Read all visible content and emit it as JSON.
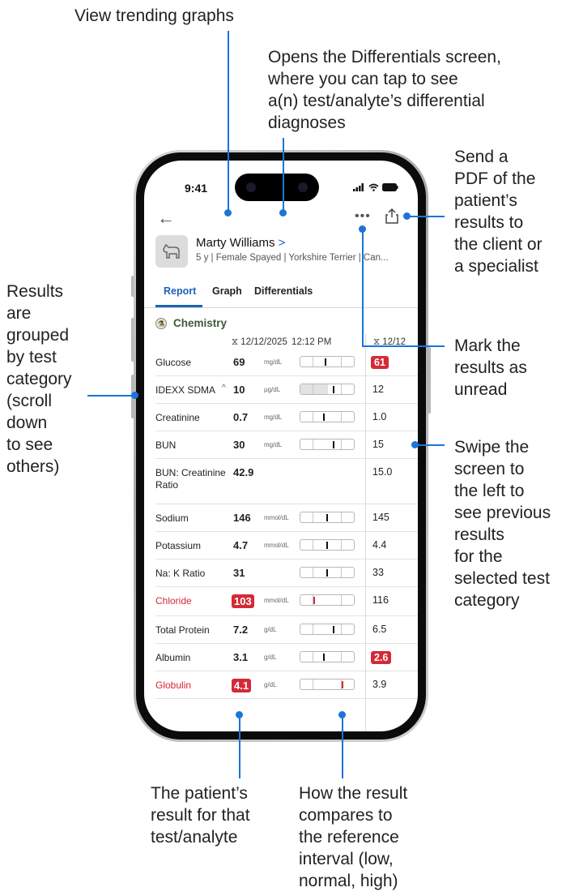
{
  "annotations": {
    "trending": "View trending graphs",
    "differentials": "Opens the Differentials screen,\nwhere you can tap to see\na(n) test/analyte’s differential\ndiagnoses",
    "send_pdf": "Send a\nPDF of the\npatient’s\nresults to\nthe client or\na specialist",
    "grouped": "Results\nare\ngrouped\nby test\ncategory\n(scroll\ndown\nto see\nothers)",
    "mark_unread": "Mark the\nresults as\nunread",
    "swipe": "Swipe the\nscreen to\nthe left to\nsee previous\nresults\nfor the\nselected test\ncategory",
    "patient_result": "The patient’s\nresult for that\ntest/analyte",
    "compare": "How the result\ncompares to\nthe reference\ninterval (low,\nnormal, high)"
  },
  "status": {
    "time": "9:41"
  },
  "patient": {
    "name": "Marty Williams",
    "chevron": ">",
    "info": "5 y | Female Spayed | Yorkshire Terrier | Can..."
  },
  "tabs": [
    {
      "label": "Report",
      "active": true
    },
    {
      "label": "Graph",
      "active": false
    },
    {
      "label": "Differentials",
      "active": false
    }
  ],
  "category": {
    "label": "Chemistry",
    "icon": "flask-icon"
  },
  "dates": {
    "current": "12/12/2025",
    "current_time": "12:12 PM",
    "previous": "12/12"
  },
  "rows": [
    {
      "name": "Glucose",
      "value": "69",
      "unit": "mg/dL",
      "prev": "61",
      "prev_flag": true,
      "value_flag": false,
      "name_flag": false,
      "marker": 0.45
    },
    {
      "name": "IDEXX SDMA",
      "trend": "^",
      "value": "10",
      "unit": "µg/dL",
      "prev": "12",
      "prev_flag": false,
      "value_flag": false,
      "name_flag": false,
      "marker": 0.6
    },
    {
      "name": "Creatinine",
      "value": "0.7",
      "unit": "mg/dL",
      "prev": "1.0",
      "prev_flag": false,
      "value_flag": false,
      "name_flag": false,
      "marker": 0.42
    },
    {
      "name": "BUN",
      "value": "30",
      "unit": "mg/dL",
      "prev": "15",
      "prev_flag": false,
      "value_flag": false,
      "name_flag": false,
      "marker": 0.6
    },
    {
      "name": "BUN: Creatinine Ratio",
      "value": "42.9",
      "unit": "",
      "prev": "15.0",
      "prev_flag": false,
      "value_flag": false,
      "name_flag": false,
      "marker": null
    },
    {
      "name": "Sodium",
      "value": "146",
      "unit": "mmol/dL",
      "prev": "145",
      "prev_flag": false,
      "value_flag": false,
      "name_flag": false,
      "marker": 0.48
    },
    {
      "name": "Potassium",
      "value": "4.7",
      "unit": "mmol/dL",
      "prev": "4.4",
      "prev_flag": false,
      "value_flag": false,
      "name_flag": false,
      "marker": 0.48
    },
    {
      "name": "Na: K Ratio",
      "value": "31",
      "unit": "",
      "prev": "33",
      "prev_flag": false,
      "value_flag": false,
      "name_flag": false,
      "marker": 0.48
    },
    {
      "name": "Chloride",
      "value": "103",
      "unit": "mmol/dL",
      "prev": "116",
      "prev_flag": false,
      "value_flag": true,
      "name_flag": true,
      "marker": 0.24
    },
    {
      "name": "Total Protein",
      "value": "7.2",
      "unit": "g/dL",
      "prev": "6.5",
      "prev_flag": false,
      "value_flag": false,
      "name_flag": false,
      "marker": 0.6
    },
    {
      "name": "Albumin",
      "value": "3.1",
      "unit": "g/dL",
      "prev": "2.6",
      "prev_flag": true,
      "value_flag": false,
      "name_flag": false,
      "marker": 0.42
    },
    {
      "name": "Globulin",
      "value": "4.1",
      "unit": "g/dL",
      "prev": "3.9",
      "prev_flag": false,
      "value_flag": true,
      "name_flag": true,
      "marker": 0.78
    }
  ]
}
